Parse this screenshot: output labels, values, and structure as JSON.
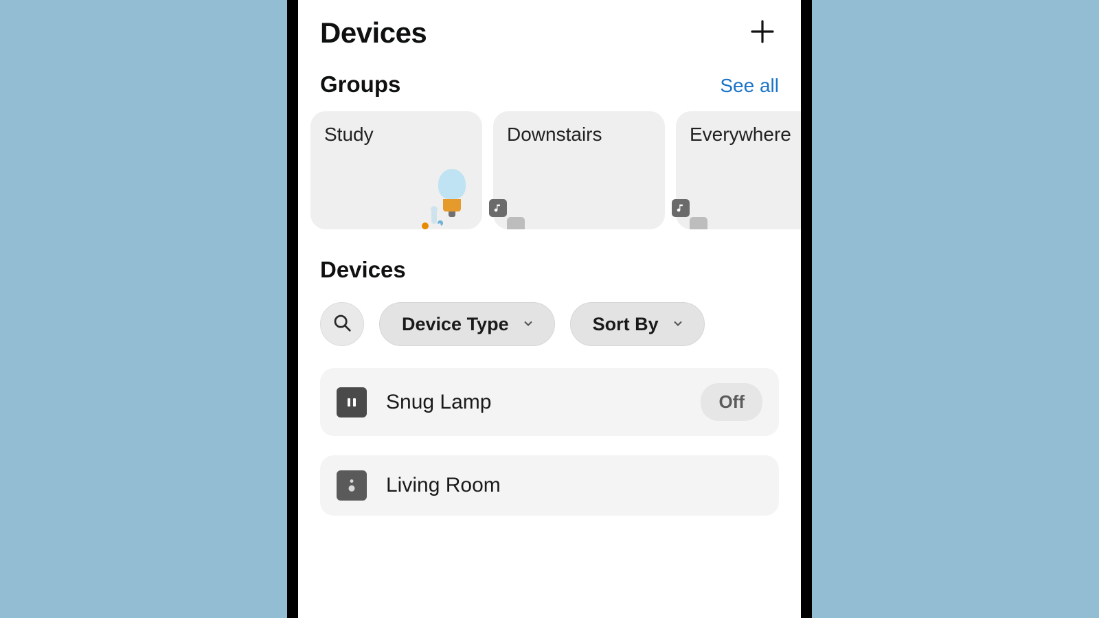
{
  "header": {
    "title": "Devices"
  },
  "groups_section": {
    "heading": "Groups",
    "see_all": "See all",
    "cards": [
      {
        "title": "Study",
        "icon_kind": "thermo_bulb"
      },
      {
        "title": "Downstairs",
        "icon_kind": "multiroom_music"
      },
      {
        "title": "Everywhere",
        "icon_kind": "multiroom_music"
      }
    ]
  },
  "devices_section": {
    "heading": "Devices",
    "filters": {
      "device_type_label": "Device Type",
      "sort_by_label": "Sort By"
    },
    "list": [
      {
        "name": "Snug Lamp",
        "icon": "plug",
        "state": "Off"
      },
      {
        "name": "Living Room",
        "icon": "speaker",
        "state": ""
      }
    ]
  },
  "colors": {
    "page_bg": "#93bdd2",
    "link": "#1a73c7"
  }
}
